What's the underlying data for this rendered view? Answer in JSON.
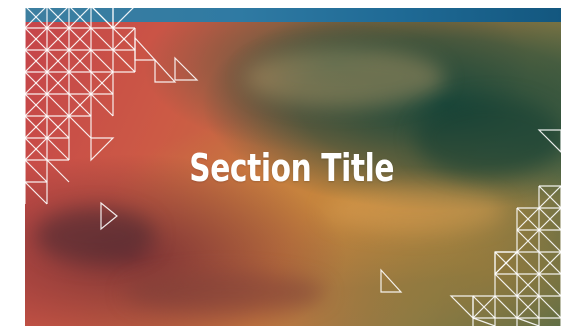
{
  "slide": {
    "title": "Section Title"
  },
  "colors": {
    "title": "#ffffff",
    "top_band": "#2f7aa3",
    "pattern_line": "#ffffff"
  },
  "icons": {
    "top_left_pattern": "triangle-grid-pattern",
    "bottom_right_pattern": "triangle-grid-pattern"
  }
}
